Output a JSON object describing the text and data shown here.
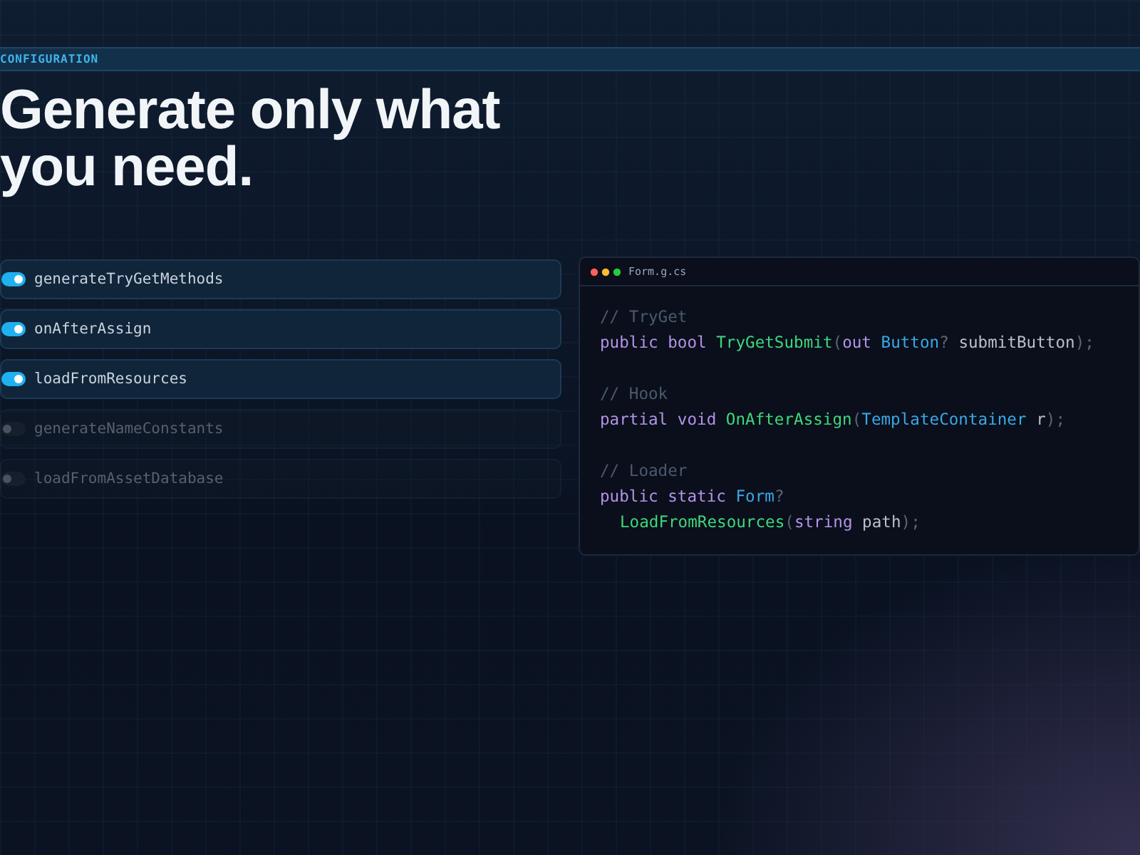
{
  "section_label": "CONFIGURATION",
  "heading": "Generate only what you need.",
  "options": [
    {
      "label": "generateTryGetMethods",
      "on": true
    },
    {
      "label": "onAfterAssign",
      "on": true
    },
    {
      "label": "loadFromResources",
      "on": true
    },
    {
      "label": "generateNameConstants",
      "on": false
    },
    {
      "label": "loadFromAssetDatabase",
      "on": false
    }
  ],
  "code_window": {
    "filename": "Form.g.cs",
    "blocks": [
      [
        {
          "indent": false,
          "tokens": [
            {
              "kind": "comment",
              "text": "// TryGet"
            }
          ]
        },
        {
          "indent": false,
          "tokens": [
            {
              "kind": "keyword",
              "text": "public bool "
            },
            {
              "kind": "method",
              "text": "TryGetSubmit"
            },
            {
              "kind": "punct",
              "text": "("
            },
            {
              "kind": "keyword",
              "text": "out "
            },
            {
              "kind": "type",
              "text": "Button"
            },
            {
              "kind": "punct",
              "text": "? "
            },
            {
              "kind": "plain",
              "text": "submitButton"
            },
            {
              "kind": "punct",
              "text": ");"
            }
          ]
        }
      ],
      [
        {
          "indent": false,
          "tokens": [
            {
              "kind": "comment",
              "text": "// Hook"
            }
          ]
        },
        {
          "indent": false,
          "tokens": [
            {
              "kind": "keyword",
              "text": "partial void "
            },
            {
              "kind": "method",
              "text": "OnAfterAssign"
            },
            {
              "kind": "punct",
              "text": "("
            },
            {
              "kind": "type",
              "text": "TemplateContainer"
            },
            {
              "kind": "plain",
              "text": " r"
            },
            {
              "kind": "punct",
              "text": ");"
            }
          ]
        }
      ],
      [
        {
          "indent": false,
          "tokens": [
            {
              "kind": "comment",
              "text": "// Loader"
            }
          ]
        },
        {
          "indent": false,
          "tokens": [
            {
              "kind": "keyword",
              "text": "public static "
            },
            {
              "kind": "type",
              "text": "Form"
            },
            {
              "kind": "punct",
              "text": "?"
            }
          ]
        },
        {
          "indent": true,
          "tokens": [
            {
              "kind": "method",
              "text": "LoadFromResources"
            },
            {
              "kind": "punct",
              "text": "("
            },
            {
              "kind": "keyword",
              "text": "string "
            },
            {
              "kind": "plain",
              "text": "path"
            },
            {
              "kind": "punct",
              "text": ");"
            }
          ]
        }
      ]
    ]
  }
}
